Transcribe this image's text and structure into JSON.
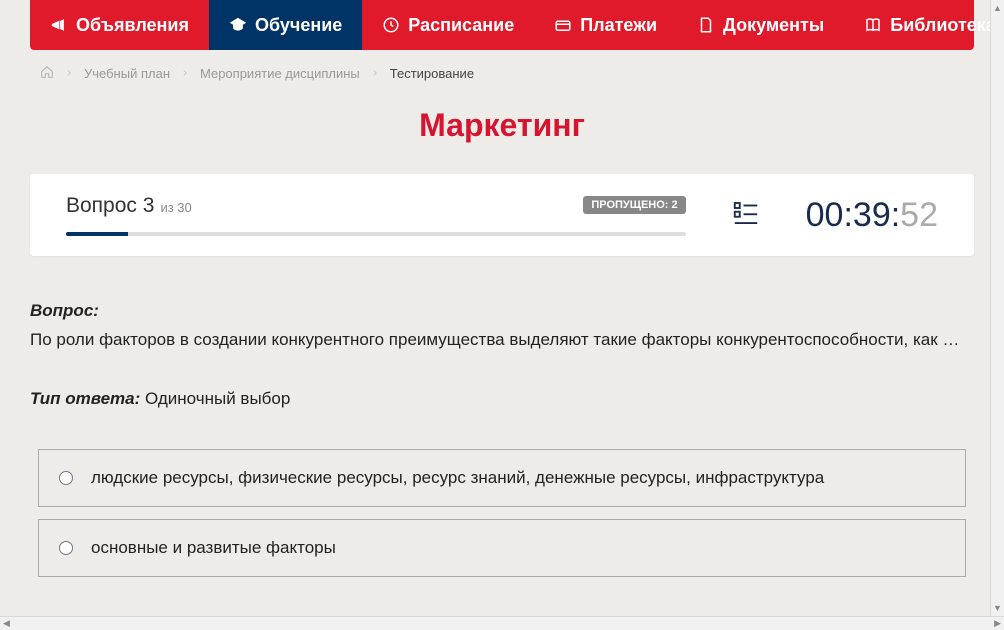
{
  "nav": [
    {
      "label": "Объявления",
      "icon": "megaphone",
      "active": false
    },
    {
      "label": "Обучение",
      "icon": "graduation",
      "active": true
    },
    {
      "label": "Расписание",
      "icon": "clock",
      "active": false
    },
    {
      "label": "Платежи",
      "icon": "card",
      "active": false
    },
    {
      "label": "Документы",
      "icon": "doc",
      "active": false
    },
    {
      "label": "Библиотека",
      "icon": "book",
      "active": false,
      "hasChevron": true
    }
  ],
  "breadcrumb": {
    "items": [
      "Учебный план",
      "Мероприятие дисциплины"
    ],
    "current": "Тестирование"
  },
  "pageTitle": "Маркетинг",
  "questionPanel": {
    "questionLabel": "Вопрос 3",
    "ofLabel": "из 30",
    "skippedLabel": "ПРОПУЩЕНО: 2",
    "progressPercent": 10,
    "timer": {
      "main": "00:39:",
      "sec": "52"
    }
  },
  "question": {
    "label": "Вопрос:",
    "text": "По роли факторов в создании конкурентного преимущества выделяют такие факторы конкурентоспособности, как …",
    "answerTypeLabel": "Тип ответа:",
    "answerType": "Одиночный выбор"
  },
  "options": [
    "людские ресурсы, физические ресурсы, ресурс знаний, денежные ресурсы, инфраструктура",
    "основные и развитые факторы"
  ]
}
